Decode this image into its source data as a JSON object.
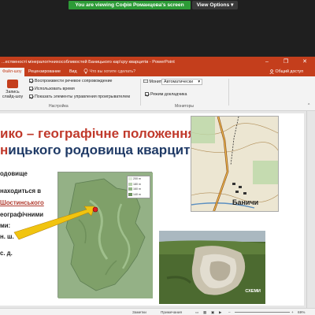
{
  "zoom": {
    "share_banner": "You are viewing Софія Романцова's screen",
    "view_options": "View Options"
  },
  "window": {
    "title": "...ественості мінералогічнихособливостей Баницького кар'єру кварцитів - PowerPoint",
    "minimize": "–",
    "maximize": "❐",
    "close": "✕"
  },
  "ribbon": {
    "active_tab": "Файл-шоу",
    "tabs": [
      "Рецензирование",
      "Вид"
    ],
    "tell_me": "Что вы хотите сделать?",
    "share": "Общий доступ",
    "record_button": "Запись слайд-шоу",
    "checkboxes": [
      "Воспроизвести речевое сопровождение",
      "Использовать время",
      "Показать элементы управления проигрывателем"
    ],
    "group_setup": "Настройка",
    "monitor_label": "Монитор:",
    "monitor_value": "Автоматически",
    "presenter_view": "Режим докладчика",
    "group_monitors": "Мониторы",
    "collapse": "^"
  },
  "slide": {
    "heading_line1": "ико – географічне положення",
    "heading_line2_red": "н",
    "heading_line2_rest": "ицького родовища кварцитів",
    "blurb_lines": [
      "одовище",
      "находиться в",
      "Шостинського",
      "еографічними",
      "ми:",
      "н. ш.",
      "с. д."
    ],
    "map_legend": [
      "200 m",
      "180 m",
      "160 m",
      "140 m"
    ],
    "topo_label": "Баничи",
    "photo_caption": "СХЕМИ"
  },
  "status": {
    "notes": "Заметки",
    "comments": "Примечания",
    "zoom": "69%"
  },
  "colors": {
    "ppt_accent": "#c43e1c",
    "heading_red": "#c0392b",
    "heading_blue": "#1f3a66",
    "zoom_green": "#2d9b37"
  }
}
